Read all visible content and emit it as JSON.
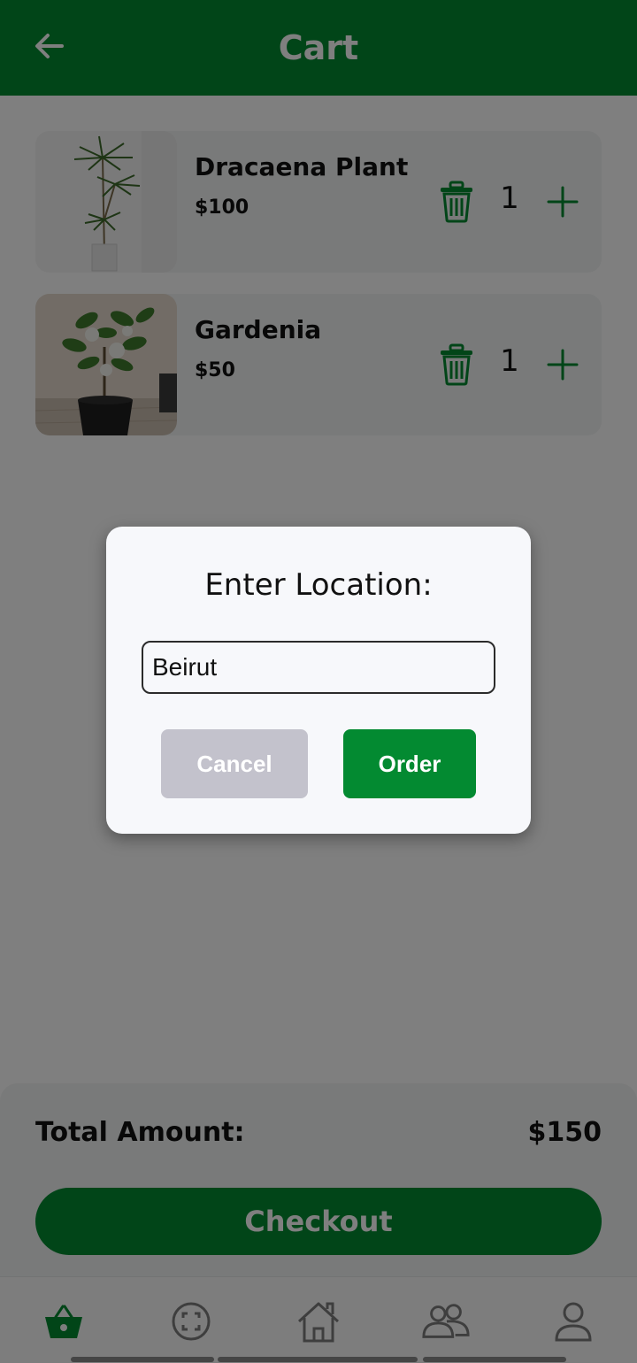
{
  "header": {
    "title": "Cart",
    "back_icon": "arrow-left-icon"
  },
  "cart": {
    "items": [
      {
        "name": "Dracaena Plant",
        "price": "$100",
        "quantity": "1"
      },
      {
        "name": "Gardenia",
        "price": "$50",
        "quantity": "1"
      }
    ]
  },
  "summary": {
    "total_label": "Total Amount:",
    "total_value": "$150",
    "checkout_label": "Checkout"
  },
  "dialog": {
    "title": "Enter Location:",
    "location_value": "Beirut",
    "cancel_label": "Cancel",
    "order_label": "Order"
  },
  "nav": {
    "items": [
      "basket-icon",
      "scan-icon",
      "home-icon",
      "community-icon",
      "profile-icon"
    ],
    "active": "basket-icon"
  },
  "colors": {
    "primary": "#038a31",
    "card": "#f2f4f4",
    "cancel": "#c3c2cc",
    "dialog": "#f7f8fb"
  }
}
